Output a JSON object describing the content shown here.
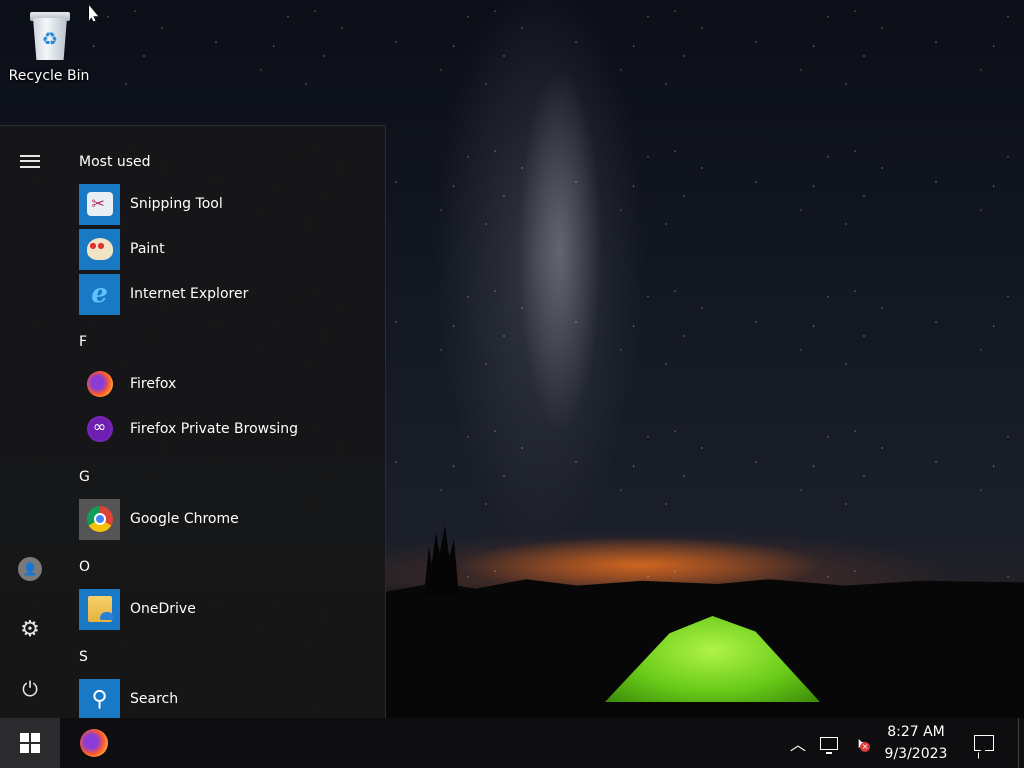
{
  "desktop": {
    "icons": [
      {
        "label": "Recycle Bin",
        "icon": "recycle-bin-icon"
      }
    ]
  },
  "start_menu": {
    "rail": {
      "menu_icon": "hamburger-menu-icon",
      "user_icon": "user-icon",
      "settings_icon": "gear-icon",
      "power_icon": "power-icon"
    },
    "sections": [
      {
        "header": "Most used"
      },
      {
        "header": "F"
      },
      {
        "header": "G"
      },
      {
        "header": "O"
      },
      {
        "header": "S"
      }
    ],
    "apps": [
      {
        "label": "Snipping Tool",
        "icon": "snipping-tool-icon"
      },
      {
        "label": "Paint",
        "icon": "paint-icon"
      },
      {
        "label": "Internet Explorer",
        "icon": "internet-explorer-icon"
      },
      {
        "label": "Firefox",
        "icon": "firefox-icon"
      },
      {
        "label": "Firefox Private Browsing",
        "icon": "firefox-private-icon"
      },
      {
        "label": "Google Chrome",
        "icon": "chrome-icon"
      },
      {
        "label": "OneDrive",
        "icon": "onedrive-icon"
      },
      {
        "label": "Search",
        "icon": "search-icon"
      }
    ]
  },
  "taskbar": {
    "start_icon": "windows-logo-icon",
    "pinned": [
      {
        "icon": "firefox-icon"
      }
    ],
    "tray": {
      "icons": [
        "chevron-up-icon",
        "network-icon",
        "volume-muted-icon"
      ],
      "time": "8:27 AM",
      "date": "9/3/2023",
      "notification_icon": "action-center-icon"
    }
  },
  "colors": {
    "start_menu_bg": "#171718",
    "taskbar_bg": "#0e0e10",
    "tile_blue": "#1979c4",
    "mute_badge": "#e03b3b"
  }
}
